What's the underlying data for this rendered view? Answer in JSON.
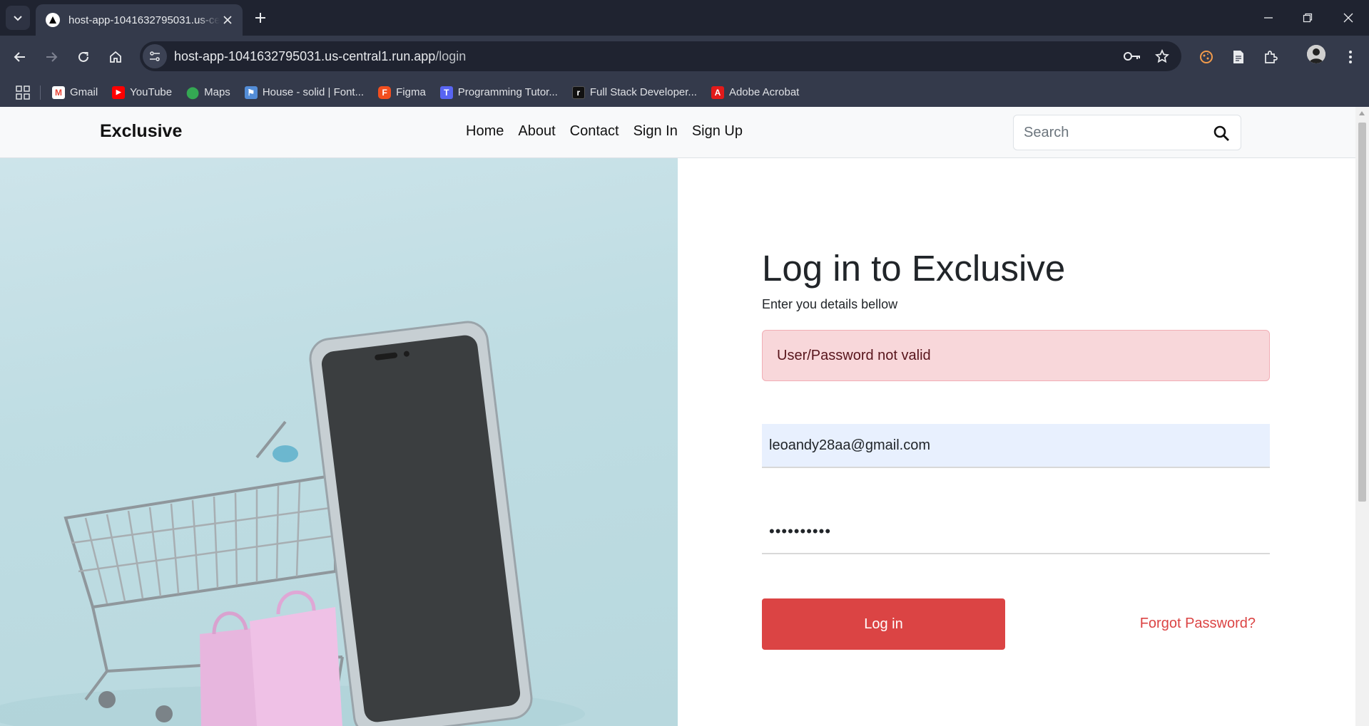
{
  "browser": {
    "tab_title": "host-app-1041632795031.us-central1.run.app/login",
    "url_host": "host-app-1041632795031.us-central1.run.app",
    "url_path": "/login",
    "bookmarks": [
      {
        "label": "Gmail",
        "icon": "gmail-icon",
        "color": "#ea4335"
      },
      {
        "label": "YouTube",
        "icon": "youtube-icon",
        "color": "#ff0000"
      },
      {
        "label": "Maps",
        "icon": "maps-icon",
        "color": "#34a853"
      },
      {
        "label": "House - solid | Font...",
        "icon": "fontawesome-icon",
        "color": "#538dd7"
      },
      {
        "label": "Figma",
        "icon": "figma-icon",
        "color": "#f24e1e"
      },
      {
        "label": "Programming Tutor...",
        "icon": "programming-tutor-icon",
        "color": "#5865f2"
      },
      {
        "label": "Full Stack Developer...",
        "icon": "fullstack-icon",
        "color": "#111111"
      },
      {
        "label": "Adobe Acrobat",
        "icon": "acrobat-icon",
        "color": "#e21a1a"
      }
    ]
  },
  "site": {
    "brand": "Exclusive",
    "nav": [
      "Home",
      "About",
      "Contact",
      "Sign In",
      "Sign Up"
    ],
    "search_placeholder": "Search"
  },
  "login": {
    "title": "Log in to Exclusive",
    "subtitle": "Enter you details bellow",
    "error": "User/Password not valid",
    "email_value": "leoandy28aa@gmail.com",
    "password_value": "••••••••••",
    "submit_label": "Log in",
    "forgot_label": "Forgot Password?",
    "accent_color": "#db4444"
  }
}
